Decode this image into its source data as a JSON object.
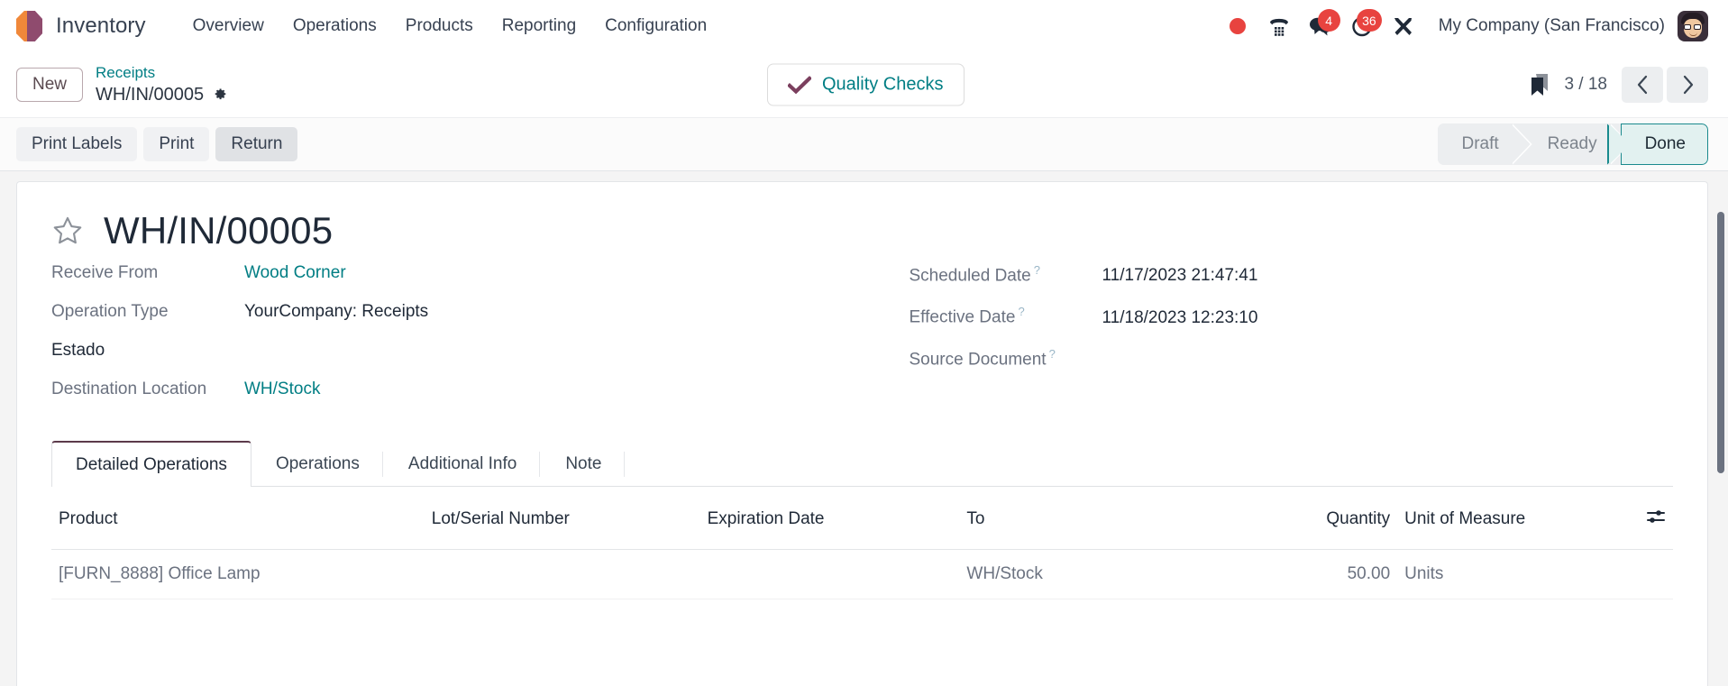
{
  "navbar": {
    "brand": "Inventory",
    "logo_colors": {
      "left": "#f0883a",
      "right": "#8f4b6e"
    },
    "menu": [
      {
        "label": "Overview"
      },
      {
        "label": "Operations"
      },
      {
        "label": "Products"
      },
      {
        "label": "Reporting"
      },
      {
        "label": "Configuration"
      }
    ],
    "sys_icons": [
      {
        "name": "recording-indicator-icon",
        "badge": null
      },
      {
        "name": "dialpad-phone-icon",
        "badge": null
      },
      {
        "name": "messages-icon",
        "badge": "4"
      },
      {
        "name": "activities-clock-icon",
        "badge": "36"
      },
      {
        "name": "developer-tools-icon",
        "badge": null
      }
    ],
    "company": "My Company (San Francisco)",
    "avatar_name": "user-avatar"
  },
  "breadcrumb": {
    "new_label": "New",
    "parent": "Receipts",
    "current": "WH/IN/00005",
    "gear_name": "settings-gear-icon"
  },
  "quality": {
    "label": "Quality Checks",
    "check_color": "#7b3f5e"
  },
  "pager": {
    "bookmark_name": "bookmark-icon",
    "count": "3 / 18",
    "prev": "‹",
    "next": "›"
  },
  "actions": {
    "buttons": [
      {
        "label": "Print Labels",
        "hovered": false
      },
      {
        "label": "Print",
        "hovered": false
      },
      {
        "label": "Return",
        "hovered": true
      }
    ]
  },
  "status": {
    "steps": [
      {
        "label": "Draft",
        "active": false
      },
      {
        "label": "Ready",
        "active": false
      },
      {
        "label": "Done",
        "active": true
      }
    ],
    "active_color": "#1a8a8d",
    "active_bg": "#e2f1f0"
  },
  "record": {
    "star_name": "favorite-star-icon",
    "title": "WH/IN/00005"
  },
  "form": {
    "left": [
      {
        "label": "Receive From",
        "value": "Wood Corner",
        "link": true,
        "strong_label": false,
        "tooltip": false
      },
      {
        "label": "Operation Type",
        "value": "YourCompany: Receipts",
        "link": false,
        "strong_label": false,
        "tooltip": false
      },
      {
        "label": "Estado",
        "value": "",
        "link": false,
        "strong_label": true,
        "tooltip": false
      },
      {
        "label": "Destination Location",
        "value": "WH/Stock",
        "link": true,
        "strong_label": false,
        "tooltip": false
      }
    ],
    "right": [
      {
        "label": "Scheduled Date",
        "value": "11/17/2023 21:47:41",
        "link": false,
        "strong_label": false,
        "tooltip": true
      },
      {
        "label": "Effective Date",
        "value": "11/18/2023 12:23:10",
        "link": false,
        "strong_label": false,
        "tooltip": true
      },
      {
        "label": "Source Document",
        "value": "",
        "link": false,
        "strong_label": false,
        "tooltip": true
      }
    ],
    "tooltip_marker": "?"
  },
  "tabs": [
    {
      "label": "Detailed Operations",
      "active": true
    },
    {
      "label": "Operations",
      "active": false
    },
    {
      "label": "Additional Info",
      "active": false
    },
    {
      "label": "Note",
      "active": false
    }
  ],
  "table": {
    "columns": [
      {
        "label": "Product",
        "align": "left"
      },
      {
        "label": "Lot/Serial Number",
        "align": "left"
      },
      {
        "label": "Expiration Date",
        "align": "left"
      },
      {
        "label": "To",
        "align": "left"
      },
      {
        "label": "Quantity",
        "align": "right"
      },
      {
        "label": "Unit of Measure",
        "align": "left"
      }
    ],
    "optional_columns_icon": "column-options-icon",
    "rows": [
      {
        "product": "[FURN_8888] Office Lamp",
        "lot_serial": "",
        "expiration_date": "",
        "to": "WH/Stock",
        "quantity": "50.00",
        "uom": "Units"
      }
    ]
  }
}
